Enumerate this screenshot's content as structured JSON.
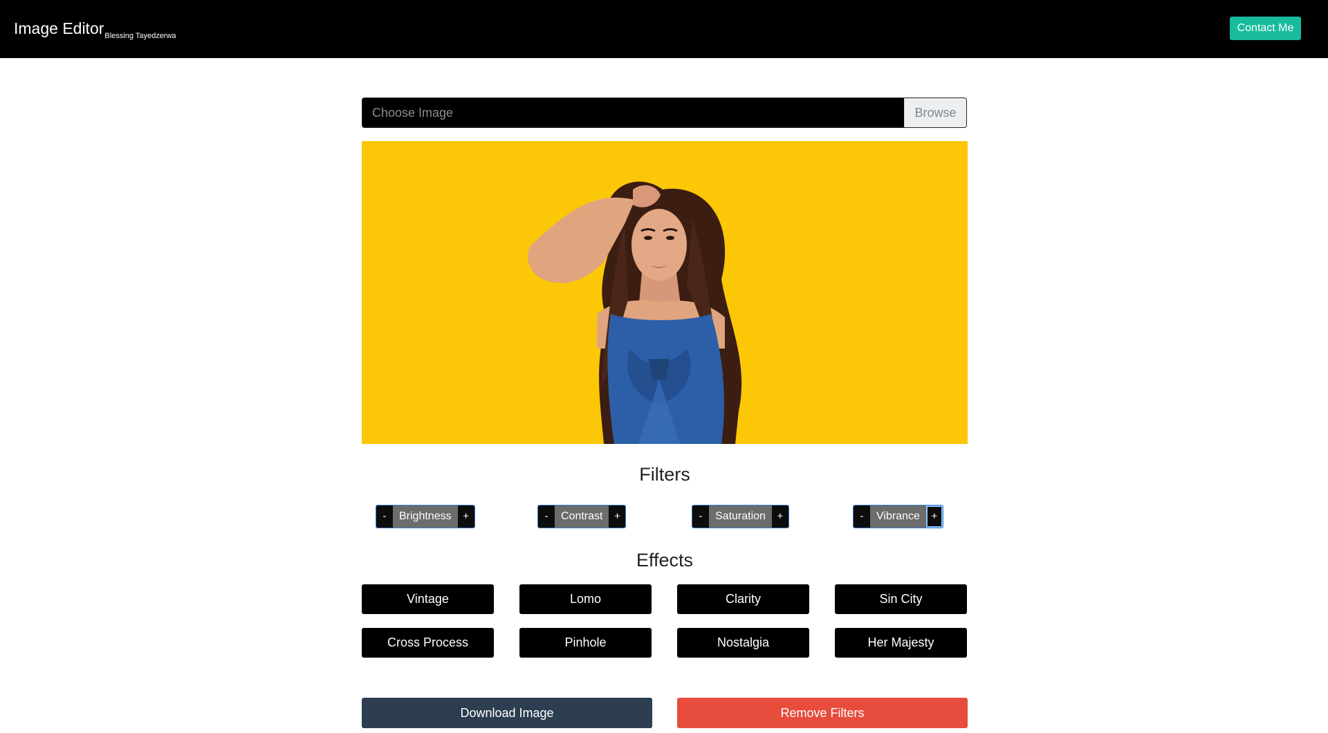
{
  "navbar": {
    "brand": "Image Editor",
    "brand_sub": "Blessing Tayedzerwa",
    "contact_label": "Contact Me"
  },
  "file_input": {
    "label": "Choose Image",
    "browse_label": "Browse"
  },
  "filters": {
    "title": "Filters",
    "items": [
      {
        "minus": "-",
        "name": "Brightness",
        "plus": "+"
      },
      {
        "minus": "-",
        "name": "Contrast",
        "plus": "+"
      },
      {
        "minus": "-",
        "name": "Saturation",
        "plus": "+"
      },
      {
        "minus": "-",
        "name": "Vibrance",
        "plus": "+"
      }
    ]
  },
  "effects": {
    "title": "Effects",
    "items": [
      "Vintage",
      "Lomo",
      "Clarity",
      "Sin City",
      "Cross Process",
      "Pinhole",
      "Nostalgia",
      "Her Majesty"
    ]
  },
  "actions": {
    "download_label": "Download Image",
    "remove_label": "Remove Filters"
  },
  "colors": {
    "navbar_bg": "#000000",
    "contact_bg": "#18bc9c",
    "download_bg": "#2c3e50",
    "remove_bg": "#e74c3c",
    "image_bg": "#fdca08"
  },
  "image": {
    "subject": "woman-on-yellow-background"
  }
}
